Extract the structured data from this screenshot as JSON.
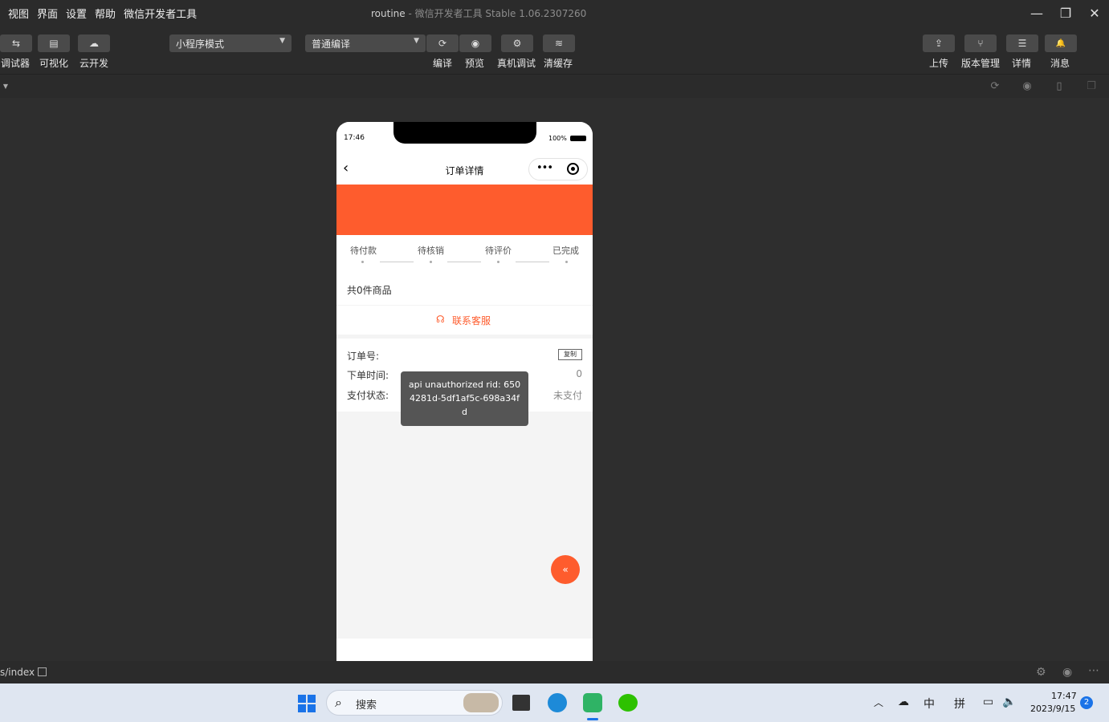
{
  "menu": [
    "视图",
    "界面",
    "设置",
    "帮助",
    "微信开发者工具"
  ],
  "window_title": "routine",
  "window_subtitle": " - 微信开发者工具 Stable 1.06.2307260",
  "toolbar": {
    "left": [
      {
        "icon": "⇆",
        "label": "调试器"
      },
      {
        "icon": "▤",
        "label": "可视化"
      },
      {
        "icon": "☁",
        "label": "云开发"
      }
    ],
    "mode_select": "小程序模式",
    "compile_select": "普通编译",
    "center": [
      {
        "icon": "⟳",
        "label": "编译"
      },
      {
        "icon": "◉",
        "label": "预览"
      },
      {
        "icon": "⚙",
        "label": "真机调试"
      },
      {
        "icon": "≋",
        "label": "清缓存"
      }
    ],
    "right": [
      {
        "icon": "⇪",
        "label": "上传"
      },
      {
        "icon": "⑂",
        "label": "版本管理"
      },
      {
        "icon": "☰",
        "label": "详情"
      },
      {
        "icon": "🔔",
        "label": "消息"
      }
    ]
  },
  "phone": {
    "time": "17:46",
    "battery": "100%",
    "nav_title": "订单详情",
    "steps": [
      "待付款",
      "待核销",
      "待评价",
      "已完成"
    ],
    "goods_count": "共0件商品",
    "service_label": "联系客服",
    "order_no_label": "订单号:",
    "copy_label": "复制",
    "order_time_label": "下单时间:",
    "order_time_value": "0",
    "pay_status_label": "支付状态:",
    "pay_status_value": "未支付",
    "toast": "api unauthorized rid: 6504281d-5df1af5c-698a34fd",
    "fab_icon": "«"
  },
  "bottom_path": "s/index",
  "taskbar": {
    "search_placeholder": "搜索",
    "ime1": "中",
    "ime2": "拼",
    "time": "17:47",
    "date": "2023/9/15",
    "notif_count": "2"
  },
  "colors": {
    "accent": "#fe5c2d",
    "ide_bg": "#2e2e2e"
  }
}
